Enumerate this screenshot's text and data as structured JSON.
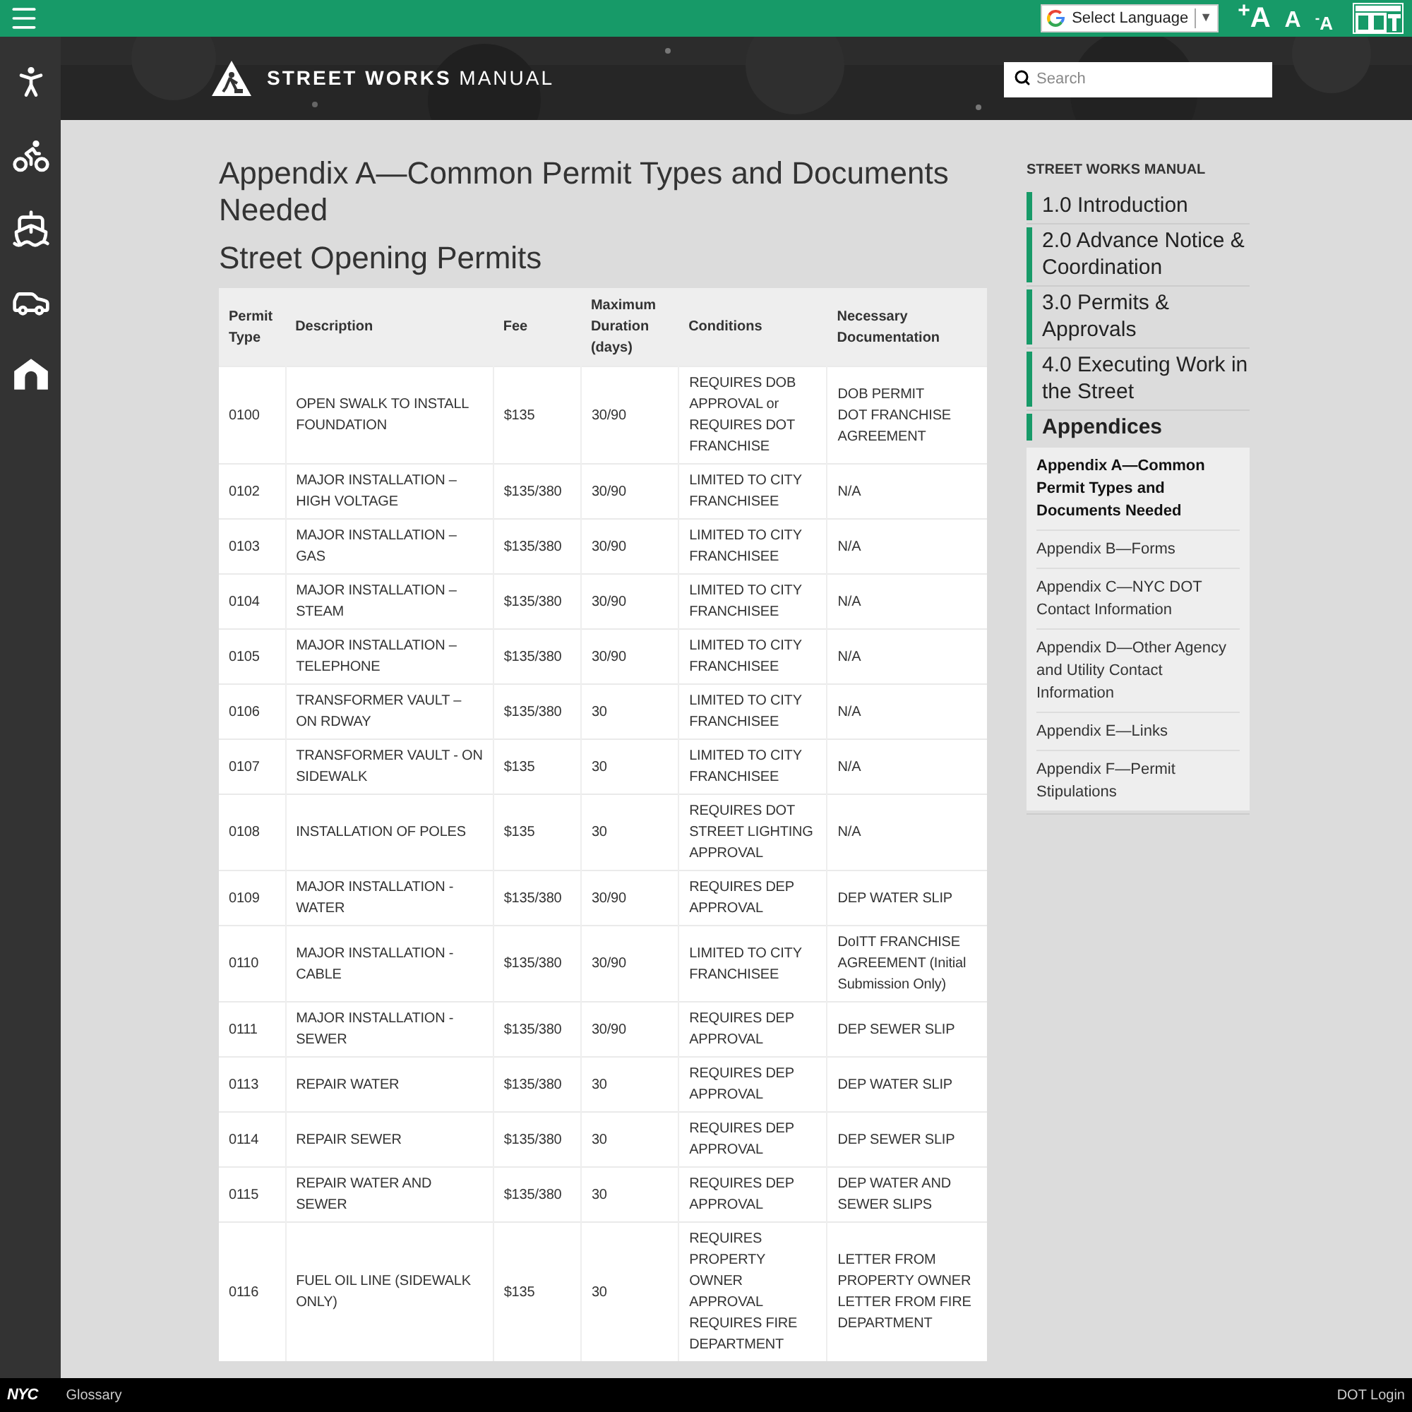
{
  "top_bar": {
    "language_select": "Select Language",
    "language_caret": "▼",
    "font_sizes": [
      {
        "label": "$^{+}$A",
        "kind": "large"
      },
      {
        "label": "A",
        "kind": "medium"
      },
      {
        "label": "$^{-}$A",
        "kind": "small"
      }
    ]
  },
  "header": {
    "logo_bold": "STREET WORKS",
    "logo_light": "MANUAL",
    "search": {
      "placeholder": "Search"
    }
  },
  "rail": [
    {
      "kind": "walk"
    },
    {
      "kind": "bike"
    },
    {
      "kind": "ferry"
    },
    {
      "kind": "car"
    },
    {
      "kind": "tunnel"
    }
  ],
  "page": {
    "title": "Appendix A—Common Permit Types and Documents Needed",
    "subtitle": "Street Opening Permits"
  },
  "table": {
    "columns": [
      "Permit Type",
      "Description",
      "Fee",
      "Maximum Duration (days)",
      "Conditions",
      "Necessary Documentation"
    ],
    "rows": [
      [
        "0100",
        "OPEN SWALK TO INSTALL FOUNDATION",
        "$135",
        "30/90",
        "REQUIRES DOB APPROVAL or REQUIRES DOT FRANCHISE",
        "DOB PERMIT\nDOT FRANCHISE AGREEMENT"
      ],
      [
        "0102",
        "MAJOR INSTALLATION – HIGH VOLTAGE",
        "$135/380",
        "30/90",
        "LIMITED TO CITY FRANCHISEE",
        "N/A"
      ],
      [
        "0103",
        "MAJOR INSTALLATION – GAS",
        "$135/380",
        "30/90",
        "LIMITED TO CITY FRANCHISEE",
        "N/A"
      ],
      [
        "0104",
        "MAJOR INSTALLATION – STEAM",
        "$135/380",
        "30/90",
        "LIMITED TO CITY FRANCHISEE",
        "N/A"
      ],
      [
        "0105",
        "MAJOR INSTALLATION – TELEPHONE",
        "$135/380",
        "30/90",
        "LIMITED TO CITY FRANCHISEE",
        "N/A"
      ],
      [
        "0106",
        "TRANSFORMER VAULT – ON RDWAY",
        "$135/380",
        "30",
        "LIMITED TO CITY FRANCHISEE",
        "N/A"
      ],
      [
        "0107",
        "TRANSFORMER VAULT - ON SIDEWALK",
        "$135",
        "30",
        "LIMITED TO CITY FRANCHISEE",
        "N/A"
      ],
      [
        "0108",
        "INSTALLATION OF POLES",
        "$135",
        "30",
        "REQUIRES DOT STREET LIGHTING APPROVAL",
        "N/A"
      ],
      [
        "0109",
        "MAJOR INSTALLATION - WATER",
        "$135/380",
        "30/90",
        "REQUIRES DEP APPROVAL",
        "DEP WATER SLIP"
      ],
      [
        "0110",
        "MAJOR INSTALLATION - CABLE",
        "$135/380",
        "30/90",
        "LIMITED TO CITY FRANCHISEE",
        "DoITT FRANCHISE AGREEMENT (Initial Submission Only)"
      ],
      [
        "0111",
        "MAJOR INSTALLATION - SEWER",
        "$135/380",
        "30/90",
        "REQUIRES DEP APPROVAL",
        "DEP SEWER SLIP"
      ],
      [
        "0113",
        "REPAIR WATER",
        "$135/380",
        "30",
        "REQUIRES DEP APPROVAL",
        "DEP WATER SLIP"
      ],
      [
        "0114",
        "REPAIR SEWER",
        "$135/380",
        "30",
        "REQUIRES DEP APPROVAL",
        "DEP SEWER SLIP"
      ],
      [
        "0115",
        "REPAIR WATER AND SEWER",
        "$135/380",
        "30",
        "REQUIRES DEP APPROVAL",
        "DEP WATER AND SEWER SLIPS"
      ],
      [
        "0116",
        "FUEL OIL LINE (SIDEWALK ONLY)",
        "$135",
        "30",
        "REQUIRES PROPERTY OWNER APPROVAL\nREQUIRES FIRE DEPARTMENT",
        "LETTER FROM PROPERTY OWNER\nLETTER FROM FIRE DEPARTMENT"
      ]
    ]
  },
  "sidebar": {
    "heading": "STREET WORKS MANUAL",
    "sections": [
      {
        "label": "1.0 Introduction",
        "selected": false
      },
      {
        "label": "2.0 Advance Notice & Coordination",
        "selected": false
      },
      {
        "label": "3.0 Permits & Approvals",
        "selected": false
      },
      {
        "label": "4.0 Executing Work in the Street",
        "selected": false
      },
      {
        "label": "Appendices",
        "selected": true,
        "children": [
          {
            "label": "Appendix A—Common Permit Types and Documents Needed",
            "selected": true
          },
          {
            "label": "Appendix B—Forms",
            "selected": false
          },
          {
            "label": "Appendix C—NYC DOT Contact Information",
            "selected": false
          },
          {
            "label": "Appendix D—Other Agency and Utility Contact Information",
            "selected": false
          },
          {
            "label": "Appendix E—Links",
            "selected": false
          },
          {
            "label": "Appendix F—Permit Stipulations",
            "selected": false
          }
        ]
      }
    ]
  },
  "footer": {
    "logo": "NYC",
    "links": [
      "Glossary"
    ],
    "login": "DOT Login"
  }
}
